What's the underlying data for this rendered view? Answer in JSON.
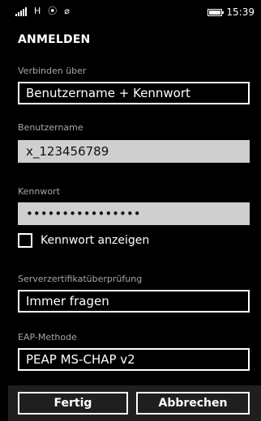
{
  "status": {
    "network": "H",
    "time": "15:39",
    "icons": [
      "signal-icon",
      "data-icon",
      "wifi-off-icon",
      "battery-icon"
    ]
  },
  "title": "ANMELDEN",
  "fields": {
    "connect_label": "Verbinden über",
    "connect_value": "Benutzername + Kennwort",
    "username_label": "Benutzername",
    "username_value": "x_123456789",
    "password_label": "Kennwort",
    "password_value": "••••••••••••••••",
    "show_password": "Kennwort anzeigen",
    "cert_label": "Serverzertifikatüberprüfung",
    "cert_value": "Immer fragen",
    "eap_label": "EAP-Methode",
    "eap_value": "PEAP MS-CHAP v2"
  },
  "buttons": {
    "done": "Fertig",
    "cancel": "Abbrechen"
  },
  "colors": {
    "background": "#000000",
    "field_gray": "#cfcfcf",
    "bottom_bar": "#1f1f1f"
  }
}
